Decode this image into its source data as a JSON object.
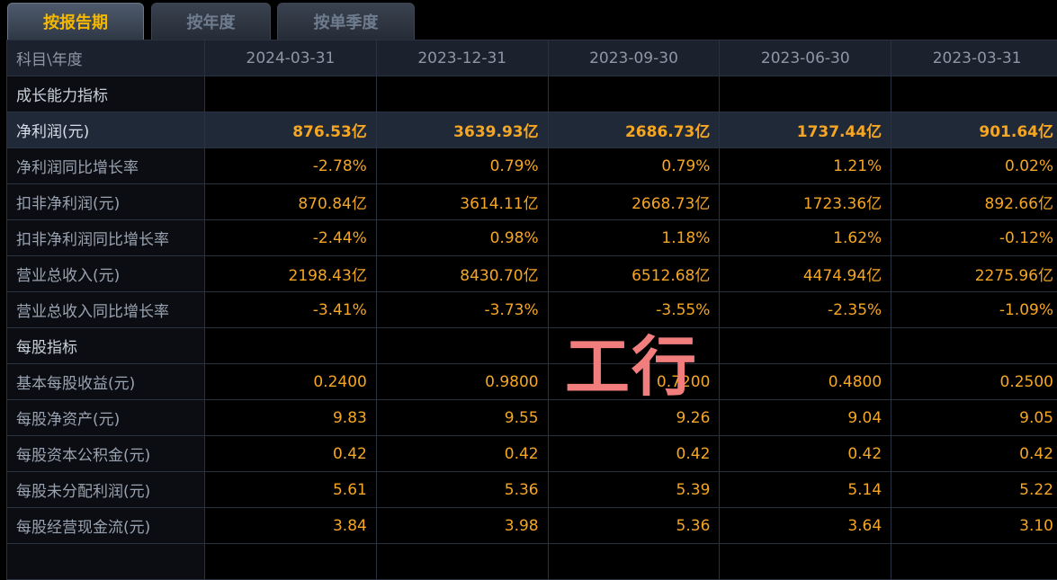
{
  "tabs": [
    {
      "label": "按报告期",
      "active": true
    },
    {
      "label": "按年度",
      "active": false
    },
    {
      "label": "按单季度",
      "active": false
    }
  ],
  "table": {
    "header_label": "科目\\年度",
    "periods": [
      "2024-03-31",
      "2023-12-31",
      "2023-09-30",
      "2023-06-30",
      "2023-03-31"
    ],
    "rows": [
      {
        "label": "成长能力指标",
        "values": [
          "",
          "",
          "",
          "",
          ""
        ]
      },
      {
        "label": "净利润(元)",
        "values": [
          "876.53亿",
          "3639.93亿",
          "2686.73亿",
          "1737.44亿",
          "901.64亿"
        ]
      },
      {
        "label": "净利润同比增长率",
        "values": [
          "-2.78%",
          "0.79%",
          "0.79%",
          "1.21%",
          "0.02%"
        ]
      },
      {
        "label": "扣非净利润(元)",
        "values": [
          "870.84亿",
          "3614.11亿",
          "2668.73亿",
          "1723.36亿",
          "892.66亿"
        ]
      },
      {
        "label": "扣非净利润同比增长率",
        "values": [
          "-2.44%",
          "0.98%",
          "1.18%",
          "1.62%",
          "-0.12%"
        ]
      },
      {
        "label": "营业总收入(元)",
        "values": [
          "2198.43亿",
          "8430.70亿",
          "6512.68亿",
          "4474.94亿",
          "2275.96亿"
        ]
      },
      {
        "label": "营业总收入同比增长率",
        "values": [
          "-3.41%",
          "-3.73%",
          "-3.55%",
          "-2.35%",
          "-1.09%"
        ]
      },
      {
        "label": "每股指标",
        "values": [
          "",
          "",
          "",
          "",
          ""
        ]
      },
      {
        "label": "基本每股收益(元)",
        "values": [
          "0.2400",
          "0.9800",
          "0.7200",
          "0.4800",
          "0.2500"
        ]
      },
      {
        "label": "每股净资产(元)",
        "values": [
          "9.83",
          "9.55",
          "9.26",
          "9.04",
          "9.05"
        ]
      },
      {
        "label": "每股资本公积金(元)",
        "values": [
          "0.42",
          "0.42",
          "0.42",
          "0.42",
          "0.42"
        ]
      },
      {
        "label": "每股未分配利润(元)",
        "values": [
          "5.61",
          "5.36",
          "5.39",
          "5.14",
          "5.22"
        ]
      },
      {
        "label": "每股经营现金流(元)",
        "values": [
          "3.84",
          "3.98",
          "5.36",
          "3.64",
          "3.10"
        ]
      },
      {
        "label": "",
        "values": [
          "",
          "",
          "",
          "",
          ""
        ]
      }
    ]
  },
  "watermark": "工行",
  "colors": {
    "accent": "#f5a623",
    "tab_active_text": "#f5b800",
    "watermark": "#f27d7d"
  }
}
